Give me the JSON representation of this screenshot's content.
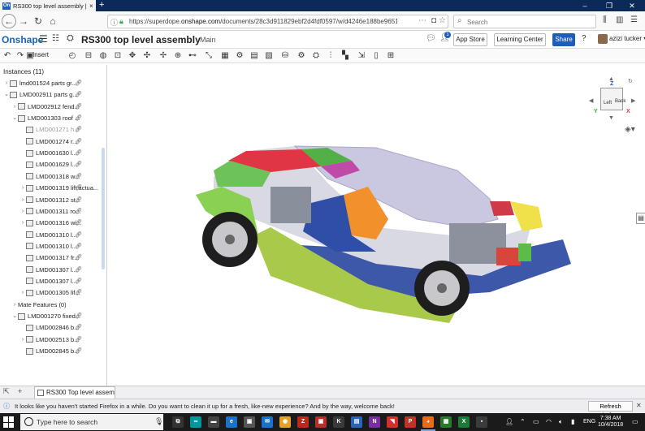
{
  "browser": {
    "tab_title": "RS300 top level assembly | RS...",
    "favicon_text": "On",
    "tab_close": "×",
    "new_tab": "+",
    "window_min": "–",
    "window_max": "❐",
    "window_close": "✕",
    "url_prefix": "https://superdope.",
    "url_domain": "onshape.com",
    "url_suffix": "/documents/28c3d911829ebf2d4fdf0597/w/d4246e188be9651579b6...",
    "search_placeholder": "Search"
  },
  "app": {
    "logo": "Onshape",
    "document_title": "RS300 top level assembly",
    "branch": "Main",
    "app_store_label": "App Store",
    "learning_center_label": "Learning Center",
    "share_label": "Share",
    "notification_count": "1",
    "help_label": "?",
    "user_name": "azizi tucker ▾"
  },
  "toolbar": {
    "insert_label": "Insert"
  },
  "tree": {
    "header": "Instances (11)",
    "rows": [
      {
        "label": "lmd001524 parts gr...",
        "indent": 0,
        "caret": "›",
        "icon": true,
        "dim": false
      },
      {
        "label": "LMD002911 parts g...",
        "indent": 0,
        "caret": "⌄",
        "icon": true,
        "dim": false
      },
      {
        "label": "LMD002912 fend...",
        "indent": 1,
        "caret": "›",
        "icon": true,
        "dim": false
      },
      {
        "label": "LMD001303 roof ...",
        "indent": 1,
        "caret": "⌄",
        "icon": true,
        "dim": false
      },
      {
        "label": "LMD001271 h...",
        "indent": 2,
        "caret": "",
        "icon": true,
        "dim": true
      },
      {
        "label": "LMD001274 r...",
        "indent": 2,
        "caret": "",
        "icon": true,
        "dim": false
      },
      {
        "label": "LMD001630 l...",
        "indent": 2,
        "caret": "",
        "icon": true,
        "dim": false
      },
      {
        "label": "LMD001629 l...",
        "indent": 2,
        "caret": "",
        "icon": true,
        "dim": false
      },
      {
        "label": "LMD001318 w...",
        "indent": 2,
        "caret": "",
        "icon": true,
        "dim": false
      },
      {
        "label": "LMD001319 lift actua...",
        "indent": 2,
        "caret": "›",
        "icon": true,
        "dim": false
      },
      {
        "label": "LMD001312 st...",
        "indent": 2,
        "caret": "›",
        "icon": true,
        "dim": false
      },
      {
        "label": "LMD001311 ro...",
        "indent": 2,
        "caret": "›",
        "icon": true,
        "dim": false
      },
      {
        "label": "LMD001316 wi...",
        "indent": 2,
        "caret": "›",
        "icon": true,
        "dim": false
      },
      {
        "label": "LMD001310 l...",
        "indent": 2,
        "caret": "",
        "icon": true,
        "dim": false
      },
      {
        "label": "LMD001310 l...",
        "indent": 2,
        "caret": "",
        "icon": true,
        "dim": false
      },
      {
        "label": "LMD001317 fr...",
        "indent": 2,
        "caret": "",
        "icon": true,
        "dim": false
      },
      {
        "label": "LMD001307 l...",
        "indent": 2,
        "caret": "",
        "icon": true,
        "dim": false
      },
      {
        "label": "LMD001307 l...",
        "indent": 2,
        "caret": "",
        "icon": true,
        "dim": false
      },
      {
        "label": "LMD001305 lif...",
        "indent": 2,
        "caret": "›",
        "icon": true,
        "dim": false
      },
      {
        "label": "Mate Features (0)",
        "indent": 1,
        "caret": "›",
        "icon": false,
        "dim": false
      },
      {
        "label": "LMD001270 fixed...",
        "indent": 1,
        "caret": "⌄",
        "icon": true,
        "dim": false
      },
      {
        "label": "LMD002846 b...",
        "indent": 2,
        "caret": "",
        "icon": true,
        "dim": false
      },
      {
        "label": "LMD002513 b...",
        "indent": 2,
        "caret": "›",
        "icon": true,
        "dim": false
      },
      {
        "label": "LMD002845 b...",
        "indent": 2,
        "caret": "",
        "icon": true,
        "dim": false
      }
    ]
  },
  "viewcube": {
    "left_face": "Left",
    "back_face": "Back",
    "axis_x": "X",
    "axis_y": "Y",
    "axis_z": "Z"
  },
  "bottom_tabs": {
    "assembly_tab": "RS300 Top level assem..."
  },
  "notice": {
    "message": "It looks like you haven't started Firefox in a while. Do you want to clean it up for a fresh, like-new experience? And by the way, welcome back!",
    "refresh_label": "Refresh Firefox...",
    "close": "✕"
  },
  "taskbar": {
    "search_placeholder": "Type here to search",
    "language": "ENG",
    "time": "7:38 AM",
    "date": "10/4/2018"
  },
  "colors": {
    "onshape_blue": "#1d5fb8",
    "tab_strip": "#0c2a57",
    "taskbar": "#1b1b1b"
  }
}
